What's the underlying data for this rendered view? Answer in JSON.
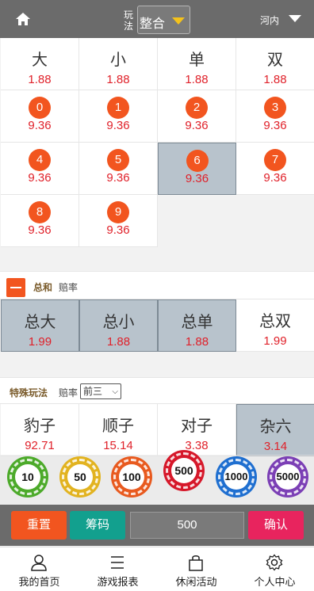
{
  "header": {
    "play_label": "玩法",
    "play_value": "整合",
    "region": "河内"
  },
  "main_bets": [
    {
      "name": "大",
      "odds": "1.88"
    },
    {
      "name": "小",
      "odds": "1.88"
    },
    {
      "name": "单",
      "odds": "1.88"
    },
    {
      "name": "双",
      "odds": "1.88"
    }
  ],
  "number_bets": [
    {
      "num": "0",
      "odds": "9.36"
    },
    {
      "num": "1",
      "odds": "9.36"
    },
    {
      "num": "2",
      "odds": "9.36"
    },
    {
      "num": "3",
      "odds": "9.36"
    },
    {
      "num": "4",
      "odds": "9.36"
    },
    {
      "num": "5",
      "odds": "9.36"
    },
    {
      "num": "6",
      "odds": "9.36",
      "selected": true
    },
    {
      "num": "7",
      "odds": "9.36"
    },
    {
      "num": "8",
      "odds": "9.36"
    },
    {
      "num": "9",
      "odds": "9.36"
    }
  ],
  "sum_section": {
    "title": "总和",
    "sub": "赔率",
    "bets": [
      {
        "name": "总大",
        "odds": "1.99",
        "selected": true
      },
      {
        "name": "总小",
        "odds": "1.88",
        "selected": true
      },
      {
        "name": "总单",
        "odds": "1.88",
        "selected": true
      },
      {
        "name": "总双",
        "odds": "1.99"
      }
    ]
  },
  "special_section": {
    "title": "特殊玩法",
    "sub": "赔率",
    "period": "前三",
    "bets": [
      {
        "name": "豹子",
        "odds": "92.71"
      },
      {
        "name": "顺子",
        "odds": "15.14"
      },
      {
        "name": "对子",
        "odds": "3.38"
      },
      {
        "name": "杂六",
        "odds": "3.14",
        "selected": true
      }
    ]
  },
  "chips": [
    {
      "label": "10",
      "color": "#4caa2a"
    },
    {
      "label": "50",
      "color": "#e2b320"
    },
    {
      "label": "100",
      "color": "#e85a1f"
    },
    {
      "label": "500",
      "color": "#d6182a"
    },
    {
      "label": "1000",
      "color": "#1f6fd0"
    },
    {
      "label": "5000",
      "color": "#7b3fb5"
    }
  ],
  "actions": {
    "reset": "重置",
    "chips": "筹码",
    "amount": "500",
    "confirm": "确认",
    "reset_color": "#f2551f",
    "chips_color": "#12a08e",
    "confirm_color": "#e8245e"
  },
  "nav": [
    {
      "label": "我的首页",
      "icon": "user-icon"
    },
    {
      "label": "游戏报表",
      "icon": "list-icon"
    },
    {
      "label": "休闲活动",
      "icon": "bag-icon"
    },
    {
      "label": "个人中心",
      "icon": "gear-icon"
    }
  ]
}
